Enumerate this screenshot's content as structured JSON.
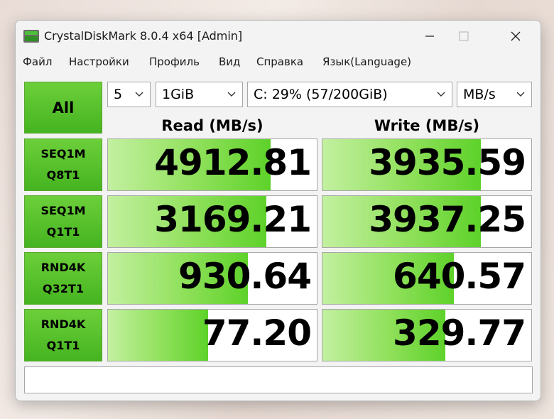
{
  "window": {
    "title": "CrystalDiskMark 8.0.4 x64 [Admin]"
  },
  "menu": [
    "Файл",
    "Настройки",
    "Профиль",
    "Вид",
    "Справка",
    "Язык(Language)"
  ],
  "controls": {
    "all_label": "All",
    "count": "5",
    "size": "1GiB",
    "drive": "C: 29% (57/200GiB)",
    "unit": "MB/s"
  },
  "headers": {
    "read": "Read (MB/s)",
    "write": "Write (MB/s)"
  },
  "tests": [
    {
      "line1": "SEQ1M",
      "line2": "Q8T1",
      "read": "4912.81",
      "write": "3935.59",
      "read_level": 0.78,
      "write_level": 0.76
    },
    {
      "line1": "SEQ1M",
      "line2": "Q1T1",
      "read": "3169.21",
      "write": "3937.25",
      "read_level": 0.76,
      "write_level": 0.76
    },
    {
      "line1": "RND4K",
      "line2": "Q32T1",
      "read": "930.64",
      "write": "640.57",
      "read_level": 0.67,
      "write_level": 0.63
    },
    {
      "line1": "RND4K",
      "line2": "Q1T1",
      "read": "77.20",
      "write": "329.77",
      "read_level": 0.48,
      "write_level": 0.59
    }
  ],
  "status_text": "",
  "icons": {
    "app": "crystaldiskmark-app-icon",
    "minimize": "minimize-icon",
    "maximize": "maximize-icon",
    "close": "close-icon",
    "dropdown": "chevron-down-icon"
  },
  "colors": {
    "button_green": "#45b420",
    "bar_green": "#5ed22a"
  }
}
